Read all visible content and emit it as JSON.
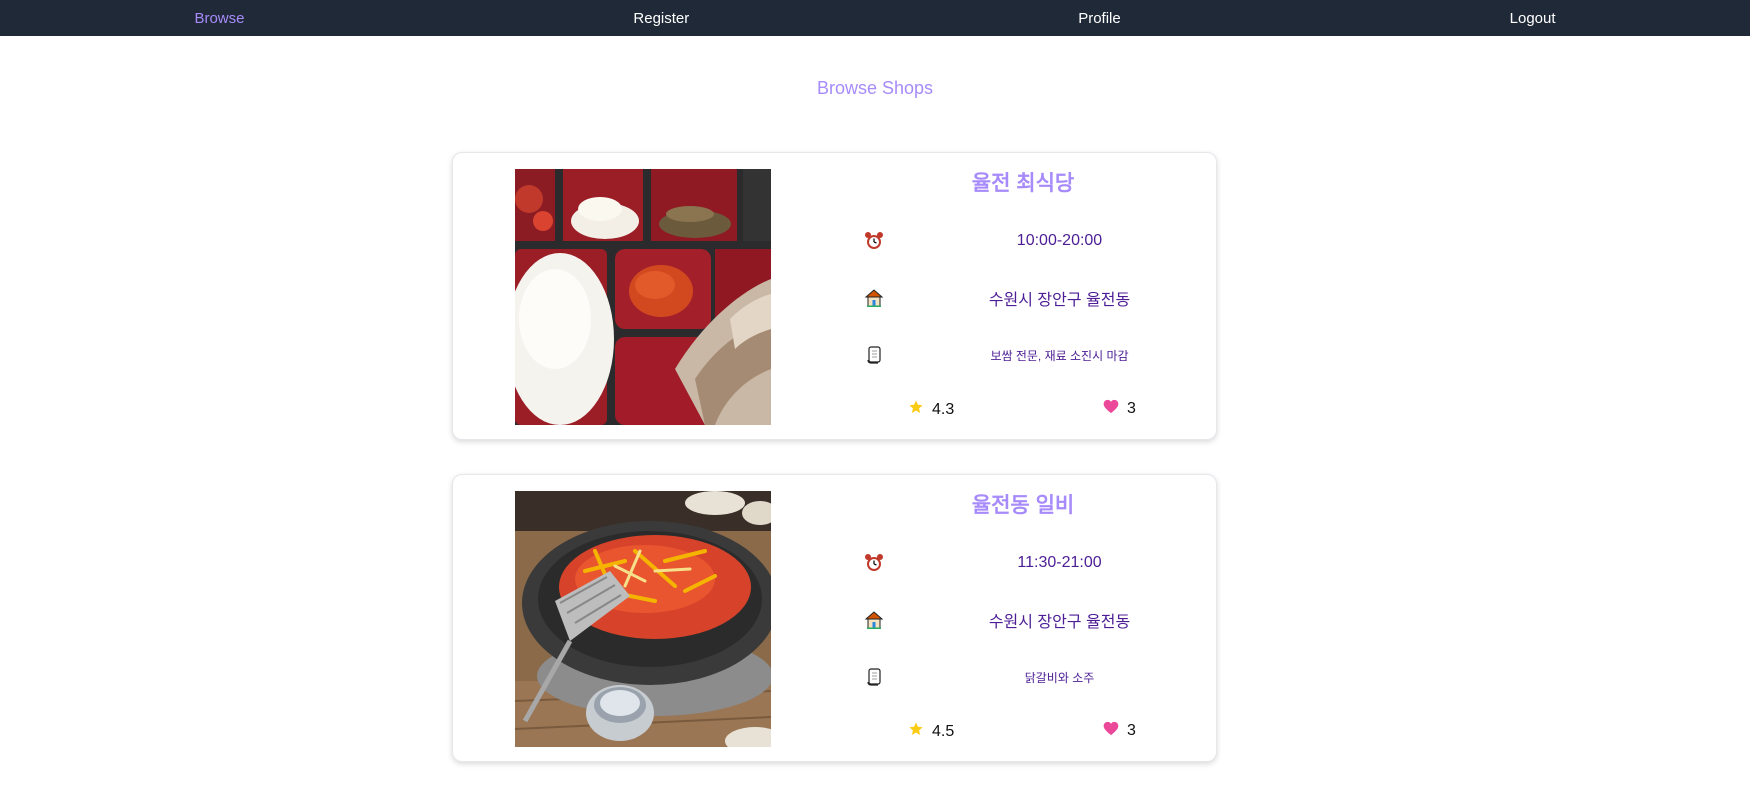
{
  "nav": {
    "browse": "Browse",
    "register": "Register",
    "profile": "Profile",
    "logout": "Logout"
  },
  "page_title": "Browse Shops",
  "shops": [
    {
      "name": "율전 최식당",
      "hours": "10:00-20:00",
      "address": "수원시 장안구 율전동",
      "description": "보쌈 전문, 재료 소진시 마감",
      "rating": "4.3",
      "likes": "3"
    },
    {
      "name": "율전동 일비",
      "hours": "11:30-21:00",
      "address": "수원시 장안구 율전동",
      "description": "닭갈비와 소주",
      "rating": "4.5",
      "likes": "3"
    }
  ],
  "icons": {
    "hours": "alarm-clock-icon",
    "address": "house-icon",
    "description": "scroll-icon",
    "rating": "star-icon",
    "likes": "heart-icon"
  },
  "colors": {
    "navbar_bg": "#1f2937",
    "accent": "#a78bfa",
    "info_text": "#4c1d95",
    "star": "#facc15",
    "heart": "#ec4899"
  }
}
